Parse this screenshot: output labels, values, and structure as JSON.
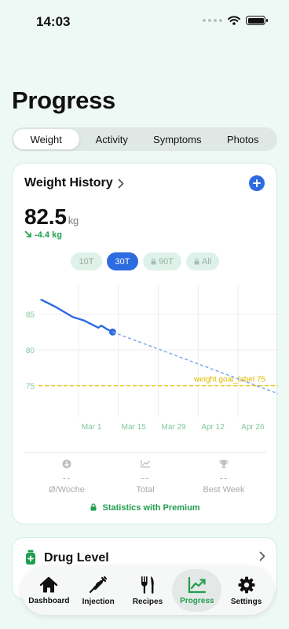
{
  "status": {
    "time": "14:03"
  },
  "page": {
    "title": "Progress"
  },
  "segments": [
    {
      "label": "Weight",
      "active": true
    },
    {
      "label": "Activity",
      "active": false
    },
    {
      "label": "Symptoms",
      "active": false
    },
    {
      "label": "Photos",
      "active": false
    }
  ],
  "weight_card": {
    "title": "Weight History",
    "add_icon": "plus-icon",
    "current_value": "82.5",
    "unit": "kg",
    "change": "-4.4 kg",
    "ranges": [
      {
        "label": "10T",
        "active": false,
        "locked": false
      },
      {
        "label": "30T",
        "active": true,
        "locked": false
      },
      {
        "label": "90T",
        "active": false,
        "locked": true
      },
      {
        "label": "All",
        "active": false,
        "locked": true
      }
    ],
    "goal_label": "weight.goal_label 75",
    "stats": [
      {
        "icon": "arrow-down-circle-icon",
        "value": "--",
        "label": "Ø/Woche"
      },
      {
        "icon": "chart-icon",
        "value": "--",
        "label": "Total"
      },
      {
        "icon": "trophy-icon",
        "value": "--",
        "label": "Best Week"
      }
    ],
    "premium_note": "Statistics with Premium"
  },
  "drug_card": {
    "title": "Drug Level"
  },
  "tabbar": [
    {
      "label": "Dashboard",
      "icon": "house-icon",
      "active": false
    },
    {
      "label": "Injection",
      "icon": "syringe-icon",
      "active": false
    },
    {
      "label": "Recipes",
      "icon": "fork-knife-icon",
      "active": false
    },
    {
      "label": "Progress",
      "icon": "progress-chart-icon",
      "active": true
    },
    {
      "label": "Settings",
      "icon": "gear-icon",
      "active": false
    }
  ],
  "colors": {
    "accent": "#2d6be0",
    "positive": "#1f9e4d",
    "goal": "#e8c300",
    "background": "#eef8f4"
  },
  "chart_data": {
    "type": "line",
    "xlabel": "",
    "ylabel": "",
    "x_tick_labels": [
      "Mar 1",
      "Mar 15",
      "Mar 29",
      "Apr 12",
      "Apr 26"
    ],
    "y_ticks": [
      75,
      80,
      85
    ],
    "ylim": [
      72,
      89
    ],
    "xlim": [
      "Feb 16",
      "May 10"
    ],
    "goal": 75,
    "series": [
      {
        "style": "solid",
        "points": [
          [
            "Feb 17",
            87.0
          ],
          [
            "Feb 19",
            86.6
          ],
          [
            "Feb 22",
            86.0
          ],
          [
            "Feb 25",
            85.3
          ],
          [
            "Feb 28",
            84.6
          ],
          [
            "Mar 3",
            84.1
          ],
          [
            "Mar 6",
            83.5
          ],
          [
            "Mar 8",
            83.1
          ],
          [
            "Mar 9",
            83.4
          ],
          [
            "Mar 11",
            82.9
          ],
          [
            "Mar 13",
            82.5
          ]
        ]
      },
      {
        "style": "dashed",
        "points": [
          [
            "Mar 13",
            82.5
          ],
          [
            "May 10",
            73.9
          ]
        ]
      }
    ]
  }
}
